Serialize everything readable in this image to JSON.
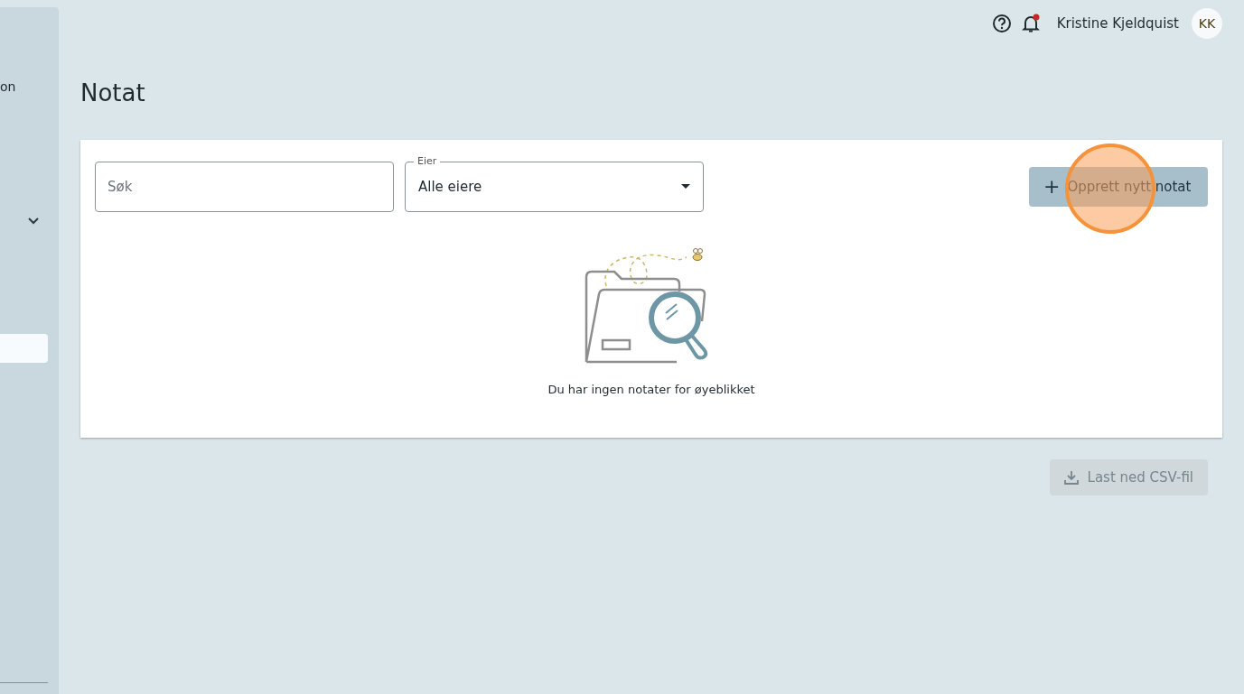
{
  "sidebar": {
    "items": [
      {
        "kind": "text",
        "label": "on"
      },
      {
        "kind": "group",
        "expanded": false
      },
      {
        "kind": "blank",
        "selected": true
      }
    ]
  },
  "header": {
    "notifications_unread": true,
    "user_name": "Kristine Kjeldquist",
    "avatar_initials": "KK"
  },
  "page_title": "Notat",
  "filters": {
    "search": {
      "placeholder": "Søk"
    },
    "owner": {
      "label": "Eier",
      "value": "Alle eiere"
    }
  },
  "create_button": {
    "label": "Opprett nytt notat",
    "icon": "+",
    "clicked": true
  },
  "empty_state": {
    "message": "Du har ingen notater for øyeblikket"
  },
  "download_button": {
    "label": "Last ned CSV-fil",
    "disabled": true
  }
}
